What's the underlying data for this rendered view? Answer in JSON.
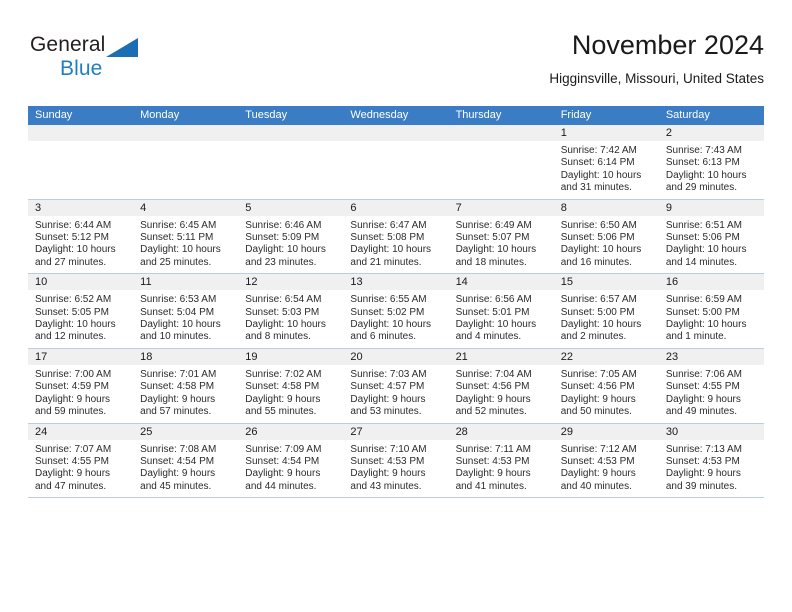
{
  "brand": {
    "name_part1": "General",
    "name_part2": "Blue",
    "accent_color": "#1b6eb3"
  },
  "header": {
    "title": "November 2024",
    "location": "Higginsville, Missouri, United States"
  },
  "calendar": {
    "header_bg_color": "#3b7dc4",
    "daynum_bg_color": "#f0f0f0",
    "grid_line_color": "#b9cde4",
    "weekdays": [
      "Sunday",
      "Monday",
      "Tuesday",
      "Wednesday",
      "Thursday",
      "Friday",
      "Saturday"
    ],
    "weeks": [
      [
        {
          "day": "",
          "sunrise": "",
          "sunset": "",
          "daylight": "",
          "daylight2": ""
        },
        {
          "day": "",
          "sunrise": "",
          "sunset": "",
          "daylight": "",
          "daylight2": ""
        },
        {
          "day": "",
          "sunrise": "",
          "sunset": "",
          "daylight": "",
          "daylight2": ""
        },
        {
          "day": "",
          "sunrise": "",
          "sunset": "",
          "daylight": "",
          "daylight2": ""
        },
        {
          "day": "",
          "sunrise": "",
          "sunset": "",
          "daylight": "",
          "daylight2": ""
        },
        {
          "day": "1",
          "sunrise": "Sunrise: 7:42 AM",
          "sunset": "Sunset: 6:14 PM",
          "daylight": "Daylight: 10 hours",
          "daylight2": "and 31 minutes."
        },
        {
          "day": "2",
          "sunrise": "Sunrise: 7:43 AM",
          "sunset": "Sunset: 6:13 PM",
          "daylight": "Daylight: 10 hours",
          "daylight2": "and 29 minutes."
        }
      ],
      [
        {
          "day": "3",
          "sunrise": "Sunrise: 6:44 AM",
          "sunset": "Sunset: 5:12 PM",
          "daylight": "Daylight: 10 hours",
          "daylight2": "and 27 minutes."
        },
        {
          "day": "4",
          "sunrise": "Sunrise: 6:45 AM",
          "sunset": "Sunset: 5:11 PM",
          "daylight": "Daylight: 10 hours",
          "daylight2": "and 25 minutes."
        },
        {
          "day": "5",
          "sunrise": "Sunrise: 6:46 AM",
          "sunset": "Sunset: 5:09 PM",
          "daylight": "Daylight: 10 hours",
          "daylight2": "and 23 minutes."
        },
        {
          "day": "6",
          "sunrise": "Sunrise: 6:47 AM",
          "sunset": "Sunset: 5:08 PM",
          "daylight": "Daylight: 10 hours",
          "daylight2": "and 21 minutes."
        },
        {
          "day": "7",
          "sunrise": "Sunrise: 6:49 AM",
          "sunset": "Sunset: 5:07 PM",
          "daylight": "Daylight: 10 hours",
          "daylight2": "and 18 minutes."
        },
        {
          "day": "8",
          "sunrise": "Sunrise: 6:50 AM",
          "sunset": "Sunset: 5:06 PM",
          "daylight": "Daylight: 10 hours",
          "daylight2": "and 16 minutes."
        },
        {
          "day": "9",
          "sunrise": "Sunrise: 6:51 AM",
          "sunset": "Sunset: 5:06 PM",
          "daylight": "Daylight: 10 hours",
          "daylight2": "and 14 minutes."
        }
      ],
      [
        {
          "day": "10",
          "sunrise": "Sunrise: 6:52 AM",
          "sunset": "Sunset: 5:05 PM",
          "daylight": "Daylight: 10 hours",
          "daylight2": "and 12 minutes."
        },
        {
          "day": "11",
          "sunrise": "Sunrise: 6:53 AM",
          "sunset": "Sunset: 5:04 PM",
          "daylight": "Daylight: 10 hours",
          "daylight2": "and 10 minutes."
        },
        {
          "day": "12",
          "sunrise": "Sunrise: 6:54 AM",
          "sunset": "Sunset: 5:03 PM",
          "daylight": "Daylight: 10 hours",
          "daylight2": "and 8 minutes."
        },
        {
          "day": "13",
          "sunrise": "Sunrise: 6:55 AM",
          "sunset": "Sunset: 5:02 PM",
          "daylight": "Daylight: 10 hours",
          "daylight2": "and 6 minutes."
        },
        {
          "day": "14",
          "sunrise": "Sunrise: 6:56 AM",
          "sunset": "Sunset: 5:01 PM",
          "daylight": "Daylight: 10 hours",
          "daylight2": "and 4 minutes."
        },
        {
          "day": "15",
          "sunrise": "Sunrise: 6:57 AM",
          "sunset": "Sunset: 5:00 PM",
          "daylight": "Daylight: 10 hours",
          "daylight2": "and 2 minutes."
        },
        {
          "day": "16",
          "sunrise": "Sunrise: 6:59 AM",
          "sunset": "Sunset: 5:00 PM",
          "daylight": "Daylight: 10 hours",
          "daylight2": "and 1 minute."
        }
      ],
      [
        {
          "day": "17",
          "sunrise": "Sunrise: 7:00 AM",
          "sunset": "Sunset: 4:59 PM",
          "daylight": "Daylight: 9 hours",
          "daylight2": "and 59 minutes."
        },
        {
          "day": "18",
          "sunrise": "Sunrise: 7:01 AM",
          "sunset": "Sunset: 4:58 PM",
          "daylight": "Daylight: 9 hours",
          "daylight2": "and 57 minutes."
        },
        {
          "day": "19",
          "sunrise": "Sunrise: 7:02 AM",
          "sunset": "Sunset: 4:58 PM",
          "daylight": "Daylight: 9 hours",
          "daylight2": "and 55 minutes."
        },
        {
          "day": "20",
          "sunrise": "Sunrise: 7:03 AM",
          "sunset": "Sunset: 4:57 PM",
          "daylight": "Daylight: 9 hours",
          "daylight2": "and 53 minutes."
        },
        {
          "day": "21",
          "sunrise": "Sunrise: 7:04 AM",
          "sunset": "Sunset: 4:56 PM",
          "daylight": "Daylight: 9 hours",
          "daylight2": "and 52 minutes."
        },
        {
          "day": "22",
          "sunrise": "Sunrise: 7:05 AM",
          "sunset": "Sunset: 4:56 PM",
          "daylight": "Daylight: 9 hours",
          "daylight2": "and 50 minutes."
        },
        {
          "day": "23",
          "sunrise": "Sunrise: 7:06 AM",
          "sunset": "Sunset: 4:55 PM",
          "daylight": "Daylight: 9 hours",
          "daylight2": "and 49 minutes."
        }
      ],
      [
        {
          "day": "24",
          "sunrise": "Sunrise: 7:07 AM",
          "sunset": "Sunset: 4:55 PM",
          "daylight": "Daylight: 9 hours",
          "daylight2": "and 47 minutes."
        },
        {
          "day": "25",
          "sunrise": "Sunrise: 7:08 AM",
          "sunset": "Sunset: 4:54 PM",
          "daylight": "Daylight: 9 hours",
          "daylight2": "and 45 minutes."
        },
        {
          "day": "26",
          "sunrise": "Sunrise: 7:09 AM",
          "sunset": "Sunset: 4:54 PM",
          "daylight": "Daylight: 9 hours",
          "daylight2": "and 44 minutes."
        },
        {
          "day": "27",
          "sunrise": "Sunrise: 7:10 AM",
          "sunset": "Sunset: 4:53 PM",
          "daylight": "Daylight: 9 hours",
          "daylight2": "and 43 minutes."
        },
        {
          "day": "28",
          "sunrise": "Sunrise: 7:11 AM",
          "sunset": "Sunset: 4:53 PM",
          "daylight": "Daylight: 9 hours",
          "daylight2": "and 41 minutes."
        },
        {
          "day": "29",
          "sunrise": "Sunrise: 7:12 AM",
          "sunset": "Sunset: 4:53 PM",
          "daylight": "Daylight: 9 hours",
          "daylight2": "and 40 minutes."
        },
        {
          "day": "30",
          "sunrise": "Sunrise: 7:13 AM",
          "sunset": "Sunset: 4:53 PM",
          "daylight": "Daylight: 9 hours",
          "daylight2": "and 39 minutes."
        }
      ]
    ]
  }
}
